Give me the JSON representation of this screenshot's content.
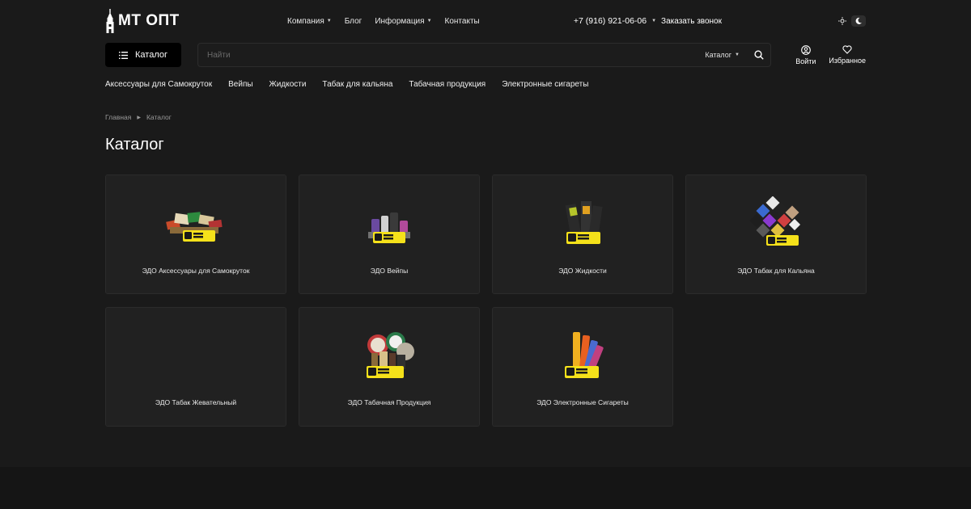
{
  "header": {
    "logo_text": "МТ ОПТ",
    "nav": [
      "Компания",
      "Блог",
      "Информация",
      "Контакты"
    ],
    "phone": "+7 (916) 921-06-06",
    "callback": "Заказать звонок"
  },
  "search": {
    "catalog_button": "Каталог",
    "placeholder": "Найти",
    "scope": "Каталог"
  },
  "user_actions": {
    "login": "Войти",
    "favorites": "Избранное"
  },
  "categories": [
    "Аксессуары для Самокруток",
    "Вейпы",
    "Жидкости",
    "Табак для кальяна",
    "Табачная продукция",
    "Электронные сигареты"
  ],
  "breadcrumb": [
    "Главная",
    "Каталог"
  ],
  "page_title": "Каталог",
  "cards": [
    {
      "label": "ЭДО Аксессуары для Самокруток",
      "badge": "ЧЕСТНЫЙ ЗНАК"
    },
    {
      "label": "ЭДО Вейпы",
      "badge": "ЧЕСТНЫЙ ЗНАК"
    },
    {
      "label": "ЭДО Жидкости",
      "badge": "ЧЕСТНЫЙ ЗНАК"
    },
    {
      "label": "ЭДО Табак для Кальяна",
      "badge": "ЧЕСТНЫЙ ЗНАК"
    },
    {
      "label": "ЭДО Табак Жевательный",
      "badge": ""
    },
    {
      "label": "ЭДО Табачная Продукция",
      "badge": "ЧЕСТНЫЙ ЗНАК"
    },
    {
      "label": "ЭДО Электронные Сигареты",
      "badge": "ЧЕСТНЫЙ ЗНАК"
    }
  ],
  "colors": {
    "background": "#1a1a1a",
    "card": "#212121",
    "badge": "#f5e11a",
    "text": "#ffffff"
  }
}
